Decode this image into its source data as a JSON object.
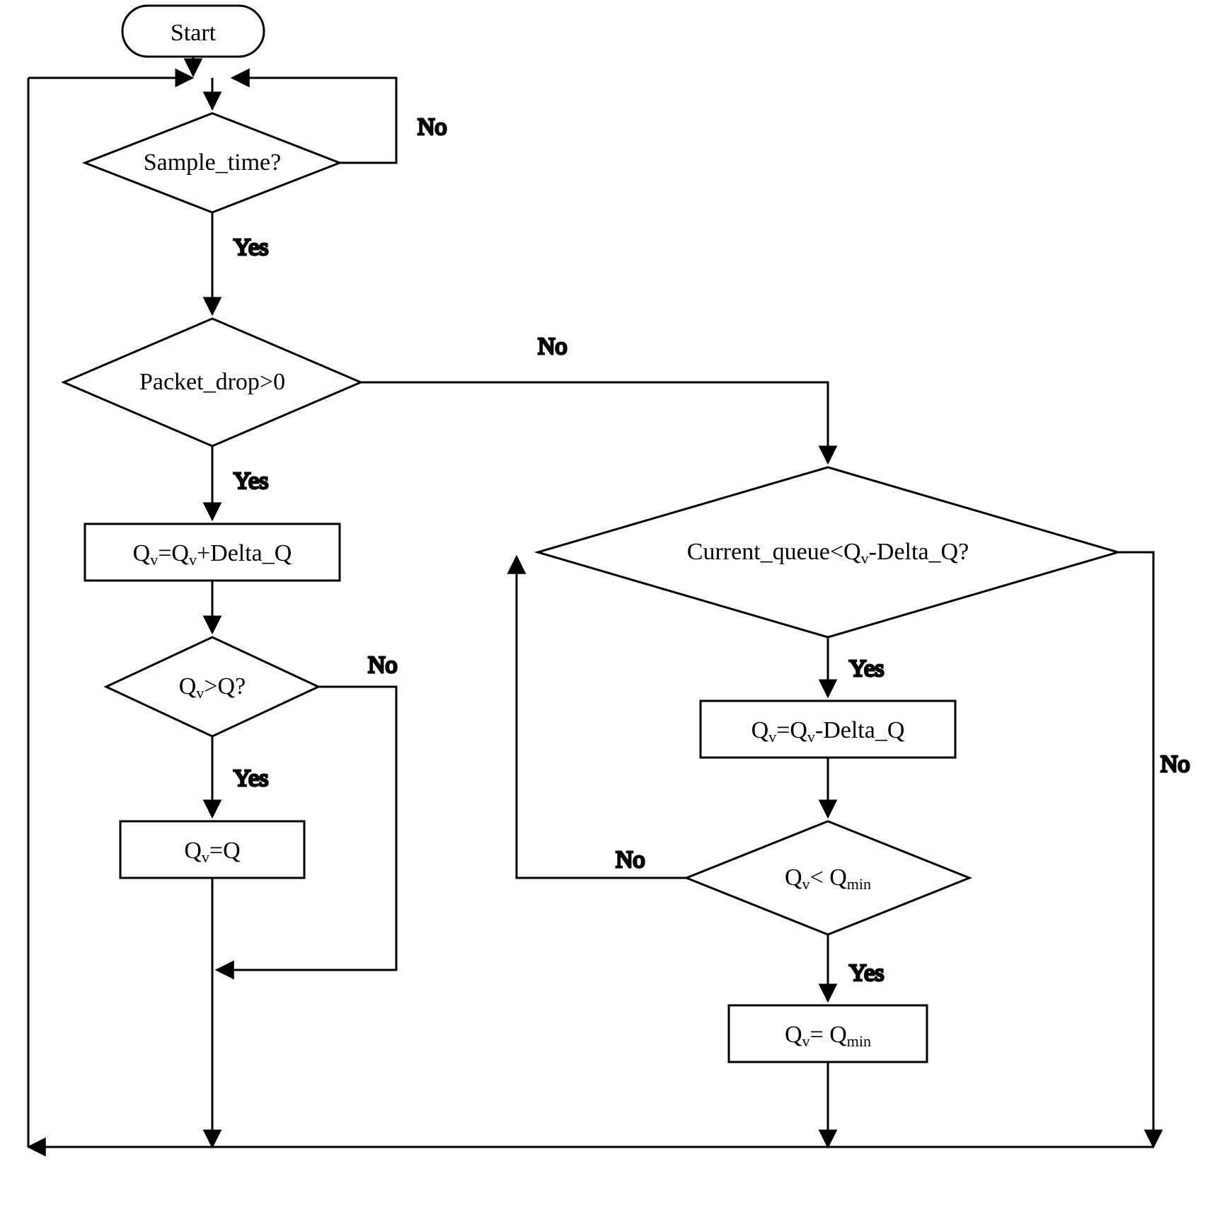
{
  "nodes": {
    "start": "Start",
    "sample_time": "Sample_time?",
    "packet_drop": "Packet_drop>0",
    "qv_plus": "Q_v=Q_v+Delta_Q",
    "qv_gt_q": "Q_v>Q?",
    "qv_eq_q": "Q_v=Q",
    "current_queue": "Current_queue<Q_v-Delta_Q?",
    "qv_minus": "Q_v=Q_v-Delta_Q",
    "qv_lt_qmin": "Q_v< Q_min",
    "qv_eq_qmin": "Q_v= Q_min"
  },
  "labels": {
    "yes": "Yes",
    "no": "No"
  }
}
